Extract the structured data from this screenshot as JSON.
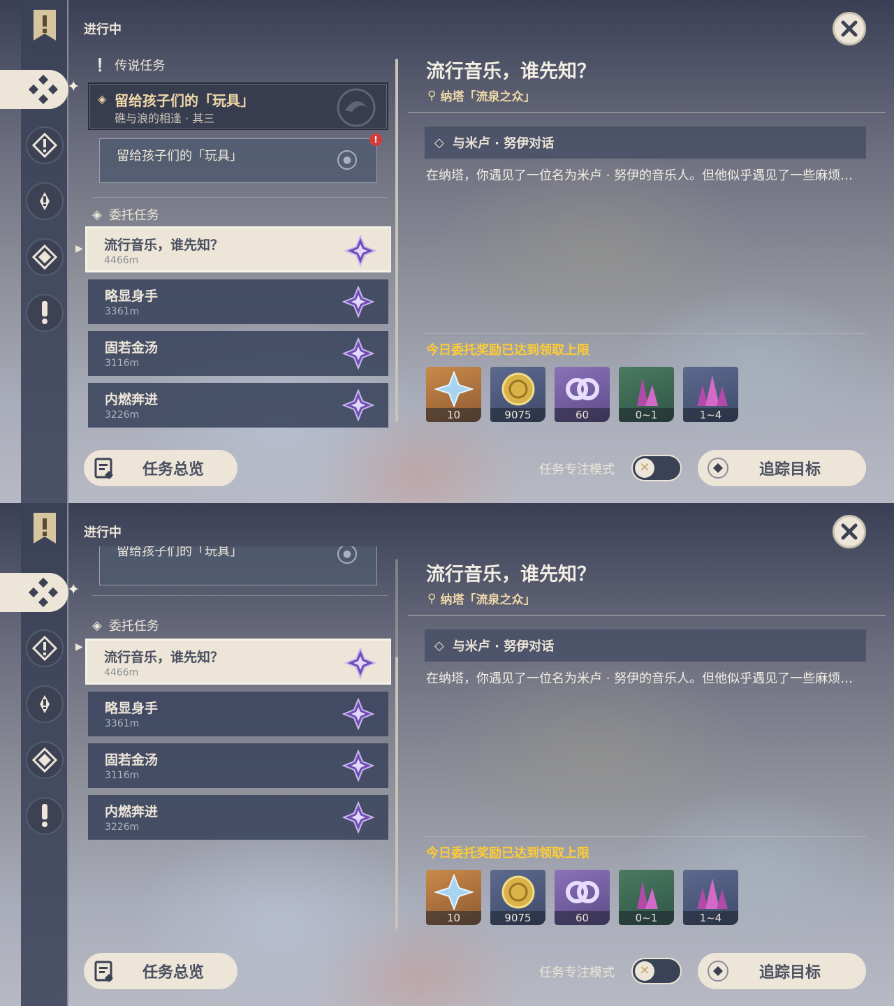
{
  "screens": [
    {
      "header": "进行中",
      "legend": {
        "section": "传说任务",
        "title": "留给孩子们的「玩具」",
        "subtitle": "礁与浪的相逢 · 其三",
        "objective": "留给孩子们的「玩具」"
      },
      "commission_section": "委托任务",
      "commissions": [
        {
          "name": "流行音乐，谁先知？",
          "distance": "4466m"
        },
        {
          "name": "略显身手",
          "distance": "3361m"
        },
        {
          "name": "固若金汤",
          "distance": "3116m"
        },
        {
          "name": "内燃奔进",
          "distance": "3226m"
        }
      ],
      "detail": {
        "title": "流行音乐，谁先知？",
        "location": "纳塔「流泉之众」",
        "step": "与米卢 · 努伊对话",
        "description": "在纳塔，你遇见了一位名为米卢 · 努伊的音乐人。但他似乎遇见了一些麻烦…",
        "reward_note": "今日委托奖励已达到领取上限",
        "rewards": [
          {
            "icon": "primogem-icon",
            "count": "10"
          },
          {
            "icon": "mora-icon",
            "count": "9075"
          },
          {
            "icon": "companionship-exp-icon",
            "count": "60"
          },
          {
            "icon": "ore-crystal-icon",
            "count": "0~1"
          },
          {
            "icon": "enhancement-crystal-icon",
            "count": "1~4"
          }
        ]
      },
      "footer": {
        "overview": "任务总览",
        "focus_mode": "任务专注模式",
        "track": "追踪目标"
      }
    },
    {
      "header": "进行中",
      "legend": {
        "objective": "留给孩子们的「玩具」"
      },
      "commission_section": "委托任务",
      "commissions": [
        {
          "name": "流行音乐，谁先知？",
          "distance": "4466m"
        },
        {
          "name": "略显身手",
          "distance": "3361m"
        },
        {
          "name": "固若金汤",
          "distance": "3116m"
        },
        {
          "name": "内燃奔进",
          "distance": "3226m"
        }
      ],
      "detail": {
        "title": "流行音乐，谁先知？",
        "location": "纳塔「流泉之众」",
        "step": "与米卢 · 努伊对话",
        "description": "在纳塔，你遇见了一位名为米卢 · 努伊的音乐人。但他似乎遇见了一些麻烦…",
        "reward_note": "今日委托奖励已达到领取上限",
        "rewards": [
          {
            "icon": "primogem-icon",
            "count": "10"
          },
          {
            "icon": "mora-icon",
            "count": "9075"
          },
          {
            "icon": "companionship-exp-icon",
            "count": "60"
          },
          {
            "icon": "ore-crystal-icon",
            "count": "0~1"
          },
          {
            "icon": "enhancement-crystal-icon",
            "count": "1~4"
          }
        ]
      },
      "footer": {
        "overview": "任务总览",
        "focus_mode": "任务专注模式",
        "track": "追踪目标"
      }
    }
  ]
}
